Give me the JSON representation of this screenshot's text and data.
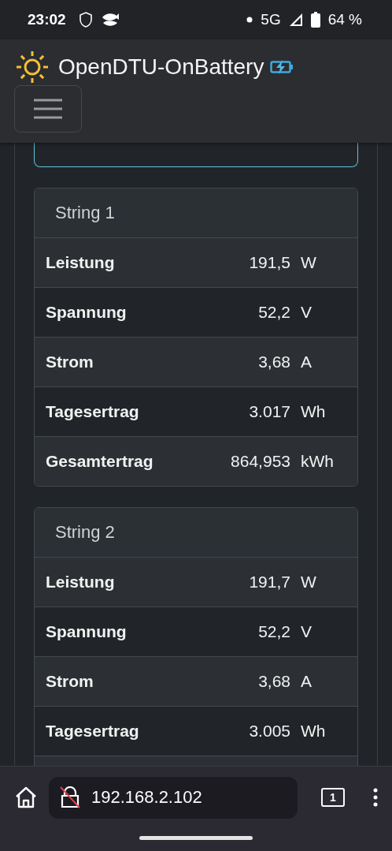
{
  "status_bar": {
    "time": "23:02",
    "network": "5G",
    "battery": "64 %"
  },
  "header": {
    "title": "OpenDTU-OnBattery"
  },
  "strings": [
    {
      "title": "String 1",
      "rows": [
        {
          "label": "Leistung",
          "value": "191,5",
          "unit": "W"
        },
        {
          "label": "Spannung",
          "value": "52,2",
          "unit": "V"
        },
        {
          "label": "Strom",
          "value": "3,68",
          "unit": "A"
        },
        {
          "label": "Tagesertrag",
          "value": "3.017",
          "unit": "Wh"
        },
        {
          "label": "Gesamtertrag",
          "value": "864,953",
          "unit": "kWh"
        }
      ]
    },
    {
      "title": "String 2",
      "rows": [
        {
          "label": "Leistung",
          "value": "191,7",
          "unit": "W"
        },
        {
          "label": "Spannung",
          "value": "52,2",
          "unit": "V"
        },
        {
          "label": "Strom",
          "value": "3,68",
          "unit": "A"
        },
        {
          "label": "Tagesertrag",
          "value": "3.005",
          "unit": "Wh"
        }
      ]
    }
  ],
  "browser": {
    "url": "192.168.2.102",
    "tab_count": "1"
  }
}
